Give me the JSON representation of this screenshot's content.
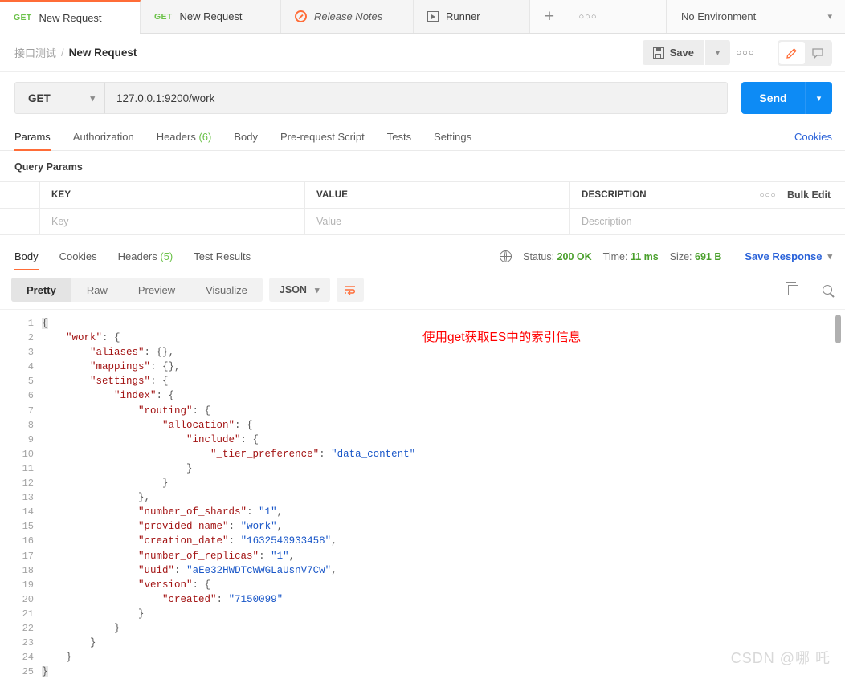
{
  "tabbar": {
    "tabs": [
      {
        "method": "GET",
        "title": "New Request",
        "unsaved": true
      },
      {
        "method": "GET",
        "title": "New Request",
        "unsaved": true
      },
      {
        "icon": "release-notes-icon",
        "title": "Release Notes"
      },
      {
        "icon": "runner-icon",
        "title": "Runner"
      }
    ],
    "new_tab_label": "+",
    "more_label": "○○○",
    "environment": "No Environment"
  },
  "header": {
    "breadcrumb_parent": "接口测试",
    "breadcrumb_sep": "/",
    "breadcrumb_current": "New Request",
    "save_label": "Save",
    "more_label": "○○○",
    "edit_icon": "pencil-icon",
    "comment_icon": "comment-icon"
  },
  "request": {
    "method": "GET",
    "url": "127.0.0.1:9200/work",
    "send_label": "Send",
    "tabs": [
      {
        "label": "Params",
        "active": true
      },
      {
        "label": "Authorization",
        "active": false
      },
      {
        "label": "Headers",
        "count": "(6)",
        "active": false
      },
      {
        "label": "Body",
        "active": false
      },
      {
        "label": "Pre-request Script",
        "active": false
      },
      {
        "label": "Tests",
        "active": false
      },
      {
        "label": "Settings",
        "active": false
      }
    ],
    "cookies_link": "Cookies"
  },
  "query_params": {
    "section_title": "Query Params",
    "columns": [
      "KEY",
      "VALUE",
      "DESCRIPTION"
    ],
    "more_label": "○○○",
    "bulk_edit_label": "Bulk Edit",
    "rows": [
      {
        "key": "",
        "value": "",
        "description": ""
      }
    ],
    "placeholders": {
      "key": "Key",
      "value": "Value",
      "description": "Description"
    }
  },
  "response": {
    "tabs": [
      {
        "label": "Body",
        "active": true
      },
      {
        "label": "Cookies",
        "active": false
      },
      {
        "label": "Headers",
        "count": "(5)",
        "active": false
      },
      {
        "label": "Test Results",
        "active": false
      }
    ],
    "status_label": "Status:",
    "status_value": "200 OK",
    "time_label": "Time:",
    "time_value": "11 ms",
    "size_label": "Size:",
    "size_value": "691 B",
    "save_response_label": "Save Response",
    "view_modes": [
      {
        "label": "Pretty",
        "active": true
      },
      {
        "label": "Raw",
        "active": false
      },
      {
        "label": "Preview",
        "active": false
      },
      {
        "label": "Visualize",
        "active": false
      }
    ],
    "format": "JSON",
    "wrap_icon": "wrap-lines-icon",
    "copy_icon": "copy-icon",
    "search_icon": "search-icon"
  },
  "annotation": "使用get获取ES中的索引信息",
  "watermark": "CSDN @哪 吒",
  "colors": {
    "accent": "#ff6c37",
    "send": "#0d8bf5",
    "link": "#2b63d9",
    "success": "#4aa02c",
    "json_key": "#a31515",
    "json_string": "#1a57c8",
    "annotation": "#ff0000"
  },
  "body_json": {
    "line_numbers": [
      1,
      2,
      3,
      4,
      5,
      6,
      7,
      8,
      9,
      10,
      11,
      12,
      13,
      14,
      15,
      16,
      17,
      18,
      19,
      20,
      21,
      22,
      23,
      24,
      25
    ],
    "lines": [
      {
        "indent": 0,
        "segments": [
          {
            "t": "{",
            "c": "p"
          }
        ]
      },
      {
        "indent": 1,
        "segments": [
          {
            "t": "\"work\"",
            "c": "k"
          },
          {
            "t": ": {",
            "c": "p"
          }
        ]
      },
      {
        "indent": 2,
        "segments": [
          {
            "t": "\"aliases\"",
            "c": "k"
          },
          {
            "t": ": {},",
            "c": "p"
          }
        ]
      },
      {
        "indent": 2,
        "segments": [
          {
            "t": "\"mappings\"",
            "c": "k"
          },
          {
            "t": ": {},",
            "c": "p"
          }
        ]
      },
      {
        "indent": 2,
        "segments": [
          {
            "t": "\"settings\"",
            "c": "k"
          },
          {
            "t": ": {",
            "c": "p"
          }
        ]
      },
      {
        "indent": 3,
        "segments": [
          {
            "t": "\"index\"",
            "c": "k"
          },
          {
            "t": ": {",
            "c": "p"
          }
        ]
      },
      {
        "indent": 4,
        "segments": [
          {
            "t": "\"routing\"",
            "c": "k"
          },
          {
            "t": ": {",
            "c": "p"
          }
        ]
      },
      {
        "indent": 5,
        "segments": [
          {
            "t": "\"allocation\"",
            "c": "k"
          },
          {
            "t": ": {",
            "c": "p"
          }
        ]
      },
      {
        "indent": 6,
        "segments": [
          {
            "t": "\"include\"",
            "c": "k"
          },
          {
            "t": ": {",
            "c": "p"
          }
        ]
      },
      {
        "indent": 7,
        "segments": [
          {
            "t": "\"_tier_preference\"",
            "c": "k"
          },
          {
            "t": ": ",
            "c": "p"
          },
          {
            "t": "\"data_content\"",
            "c": "s"
          }
        ]
      },
      {
        "indent": 6,
        "segments": [
          {
            "t": "}",
            "c": "p"
          }
        ]
      },
      {
        "indent": 5,
        "segments": [
          {
            "t": "}",
            "c": "p"
          }
        ]
      },
      {
        "indent": 4,
        "segments": [
          {
            "t": "},",
            "c": "p"
          }
        ]
      },
      {
        "indent": 4,
        "segments": [
          {
            "t": "\"number_of_shards\"",
            "c": "k"
          },
          {
            "t": ": ",
            "c": "p"
          },
          {
            "t": "\"1\"",
            "c": "s"
          },
          {
            "t": ",",
            "c": "p"
          }
        ]
      },
      {
        "indent": 4,
        "segments": [
          {
            "t": "\"provided_name\"",
            "c": "k"
          },
          {
            "t": ": ",
            "c": "p"
          },
          {
            "t": "\"work\"",
            "c": "s"
          },
          {
            "t": ",",
            "c": "p"
          }
        ]
      },
      {
        "indent": 4,
        "segments": [
          {
            "t": "\"creation_date\"",
            "c": "k"
          },
          {
            "t": ": ",
            "c": "p"
          },
          {
            "t": "\"1632540933458\"",
            "c": "s"
          },
          {
            "t": ",",
            "c": "p"
          }
        ]
      },
      {
        "indent": 4,
        "segments": [
          {
            "t": "\"number_of_replicas\"",
            "c": "k"
          },
          {
            "t": ": ",
            "c": "p"
          },
          {
            "t": "\"1\"",
            "c": "s"
          },
          {
            "t": ",",
            "c": "p"
          }
        ]
      },
      {
        "indent": 4,
        "segments": [
          {
            "t": "\"uuid\"",
            "c": "k"
          },
          {
            "t": ": ",
            "c": "p"
          },
          {
            "t": "\"aEe32HWDTcWWGLaUsnV7Cw\"",
            "c": "s"
          },
          {
            "t": ",",
            "c": "p"
          }
        ]
      },
      {
        "indent": 4,
        "segments": [
          {
            "t": "\"version\"",
            "c": "k"
          },
          {
            "t": ": {",
            "c": "p"
          }
        ]
      },
      {
        "indent": 5,
        "segments": [
          {
            "t": "\"created\"",
            "c": "k"
          },
          {
            "t": ": ",
            "c": "p"
          },
          {
            "t": "\"7150099\"",
            "c": "s"
          }
        ]
      },
      {
        "indent": 4,
        "segments": [
          {
            "t": "}",
            "c": "p"
          }
        ]
      },
      {
        "indent": 3,
        "segments": [
          {
            "t": "}",
            "c": "p"
          }
        ]
      },
      {
        "indent": 2,
        "segments": [
          {
            "t": "}",
            "c": "p"
          }
        ]
      },
      {
        "indent": 1,
        "segments": [
          {
            "t": "}",
            "c": "p"
          }
        ]
      },
      {
        "indent": 0,
        "segments": [
          {
            "t": "}",
            "c": "p"
          }
        ]
      }
    ]
  }
}
